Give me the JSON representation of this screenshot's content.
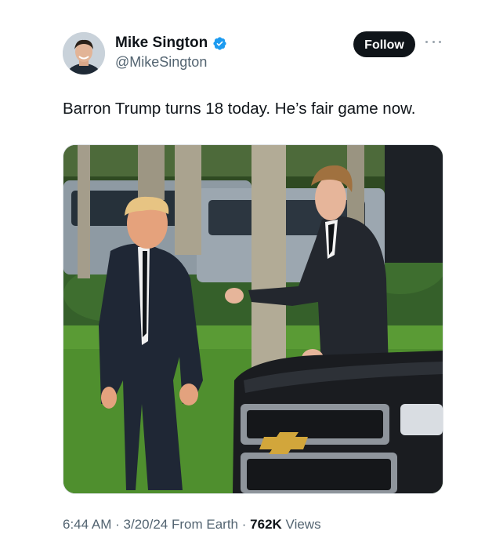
{
  "author": {
    "display_name": "Mike Sington",
    "handle": "@MikeSington",
    "verified": true,
    "avatar": "profile-photo"
  },
  "follow_label": "Follow",
  "more_icon": "more-horizontal-icon",
  "tweet": {
    "text": "Barron Trump turns 18 today. He’s fair game now.",
    "media": "photo"
  },
  "meta": {
    "time": "6:44 AM",
    "date": "3/20/24",
    "source": "From Earth",
    "views_count": "762K",
    "views_label": "Views",
    "separator": "·"
  },
  "colors": {
    "text": "#0f1419",
    "secondary": "#536471",
    "verified_badge": "#1d9bf0",
    "follow_bg": "#0f1419"
  }
}
